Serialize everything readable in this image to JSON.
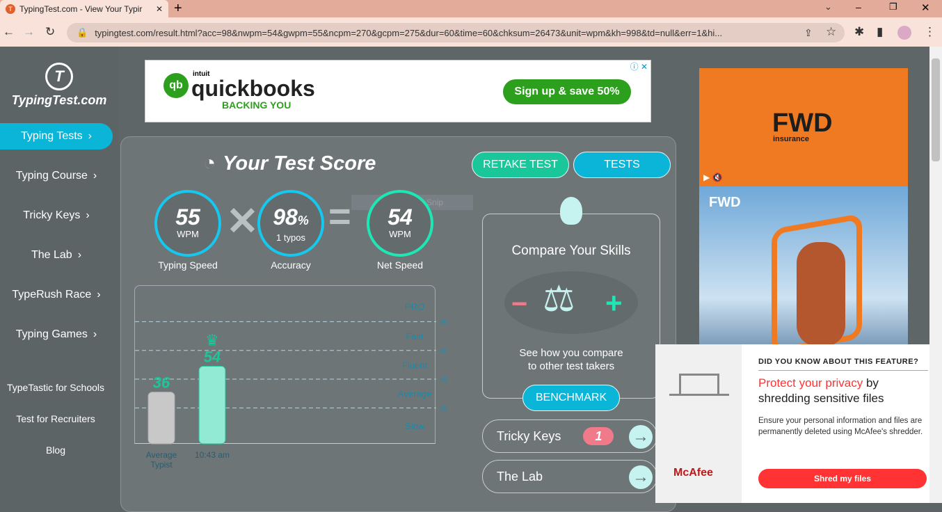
{
  "browser": {
    "tab_title": "TypingTest.com - View Your Typir",
    "new_tab": "+",
    "url": "typingtest.com/result.html?acc=98&nwpm=54&gwpm=55&ncpm=270&gcpm=275&dur=60&time=60&chksum=26473&unit=wpm&kh=998&td=null&err=1&hi..."
  },
  "logo": {
    "mark": "T",
    "text": "TypingTest.com"
  },
  "sidebar": {
    "items": [
      {
        "label": "Typing Tests"
      },
      {
        "label": "Typing Course"
      },
      {
        "label": "Tricky Keys"
      },
      {
        "label": "The Lab"
      },
      {
        "label": "TypeRush Race"
      },
      {
        "label": "Typing Games"
      }
    ],
    "links": [
      "TypeTastic for Schools",
      "Test for Recruiters",
      "Blog"
    ]
  },
  "ad_top": {
    "brand_small": "intuit",
    "brand": "quickbooks",
    "tagline": "BACKING YOU",
    "cta": "Sign up & save 50%"
  },
  "score": {
    "title": "Your Test Score",
    "retake": "RETAKE TEST",
    "tests": "TESTS",
    "typing_speed": {
      "value": "55",
      "unit": "WPM",
      "label": "Typing Speed"
    },
    "accuracy": {
      "value": "98",
      "unit": "%",
      "sub": "1  typos",
      "label": "Accuracy"
    },
    "net_speed": {
      "value": "54",
      "unit": "WPM",
      "label": "Net Speed"
    },
    "snip_overlay": "Rectangular Snip"
  },
  "chart_data": {
    "type": "bar",
    "categories": [
      "Average Typist",
      "10:43 am"
    ],
    "values": [
      36,
      54
    ],
    "value_labels": [
      "36",
      "54"
    ],
    "bands": [
      "PRO",
      "Fast",
      "Fluent",
      "Average",
      "Slow"
    ],
    "gridlines": [
      85,
      65,
      45,
      25
    ],
    "gridline_labels": [
      "85",
      "65",
      "45",
      "25"
    ],
    "ylim": [
      0,
      106
    ],
    "colors": [
      "#c8c8c8",
      "#92ead5"
    ]
  },
  "compare": {
    "title": "Compare Your Skills",
    "text1": "See how you compare",
    "text2": "to other test takers",
    "button": "BENCHMARK"
  },
  "pills": [
    {
      "label": "Tricky Keys",
      "badge": "1"
    },
    {
      "label": "The Lab"
    }
  ],
  "ad_right": {
    "brand": "FWD",
    "sub": "insurance"
  },
  "mcafee": {
    "kicker": "DID YOU KNOW ABOUT THIS FEATURE?",
    "headline_red": "Protect your privacy",
    "headline_rest": " by",
    "headline2": "shredding sensitive files",
    "body": "Ensure your personal information and files are permanently deleted using McAfee's shredder.",
    "cta": "Shred my files",
    "brand": "McAfee"
  }
}
